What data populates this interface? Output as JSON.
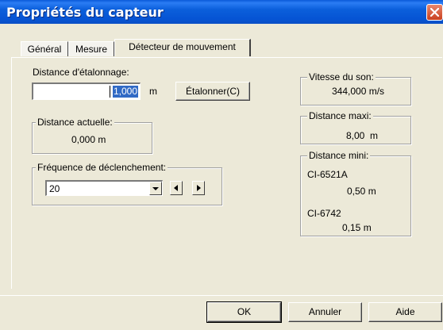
{
  "window": {
    "title": "Propriétés du capteur"
  },
  "tabs": [
    {
      "label": "Général"
    },
    {
      "label": "Mesure"
    },
    {
      "label": "Détecteur de mouvement",
      "active": true
    }
  ],
  "calibration": {
    "label": "Distance d'étalonnage:",
    "value": "1,000",
    "unit": "m",
    "button_label": "Étalonner(C)"
  },
  "current_distance": {
    "title": "Distance actuelle:",
    "value": "0,000 m"
  },
  "trigger_frequency": {
    "title": "Fréquence de déclenchement:",
    "selected": "20"
  },
  "sound_speed": {
    "title": "Vitesse du son:",
    "value": "344,000 m/s"
  },
  "max_distance": {
    "title": "Distance maxi:",
    "value": "8,00  m"
  },
  "min_distance": {
    "title": "Distance mini:",
    "sensors": [
      {
        "name": "CI-6521A",
        "value": "0,50 m"
      },
      {
        "name": "CI-6742",
        "value": "0,15 m"
      }
    ]
  },
  "footer": {
    "ok_label": "OK",
    "cancel_label": "Annuler",
    "help_label": "Aide"
  },
  "icons": {
    "close": "close-icon",
    "dropdown": "chevron-down-icon",
    "spin_left": "triangle-left-icon",
    "spin_right": "triangle-right-icon"
  },
  "colors": {
    "titlebar": "#0654d4",
    "close": "#c9401f",
    "face": "#ece9d8",
    "selection": "#316ac5"
  }
}
